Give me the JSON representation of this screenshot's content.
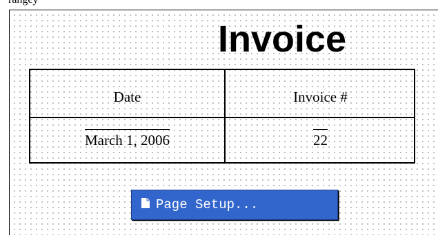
{
  "header": {
    "cut_off_text": "rangey"
  },
  "invoice": {
    "title": "Invoice",
    "table": {
      "date_header": "Date",
      "invoice_number_header": "Invoice #",
      "date_value": "March 1, 2006",
      "invoice_number_value": "22"
    }
  },
  "actions": {
    "page_setup_label": "Page Setup...",
    "page_setup_icon": "page-icon"
  },
  "colors": {
    "button_background": "#3366cc",
    "grid_dots": "#b9b9b9",
    "text": "#000000"
  }
}
